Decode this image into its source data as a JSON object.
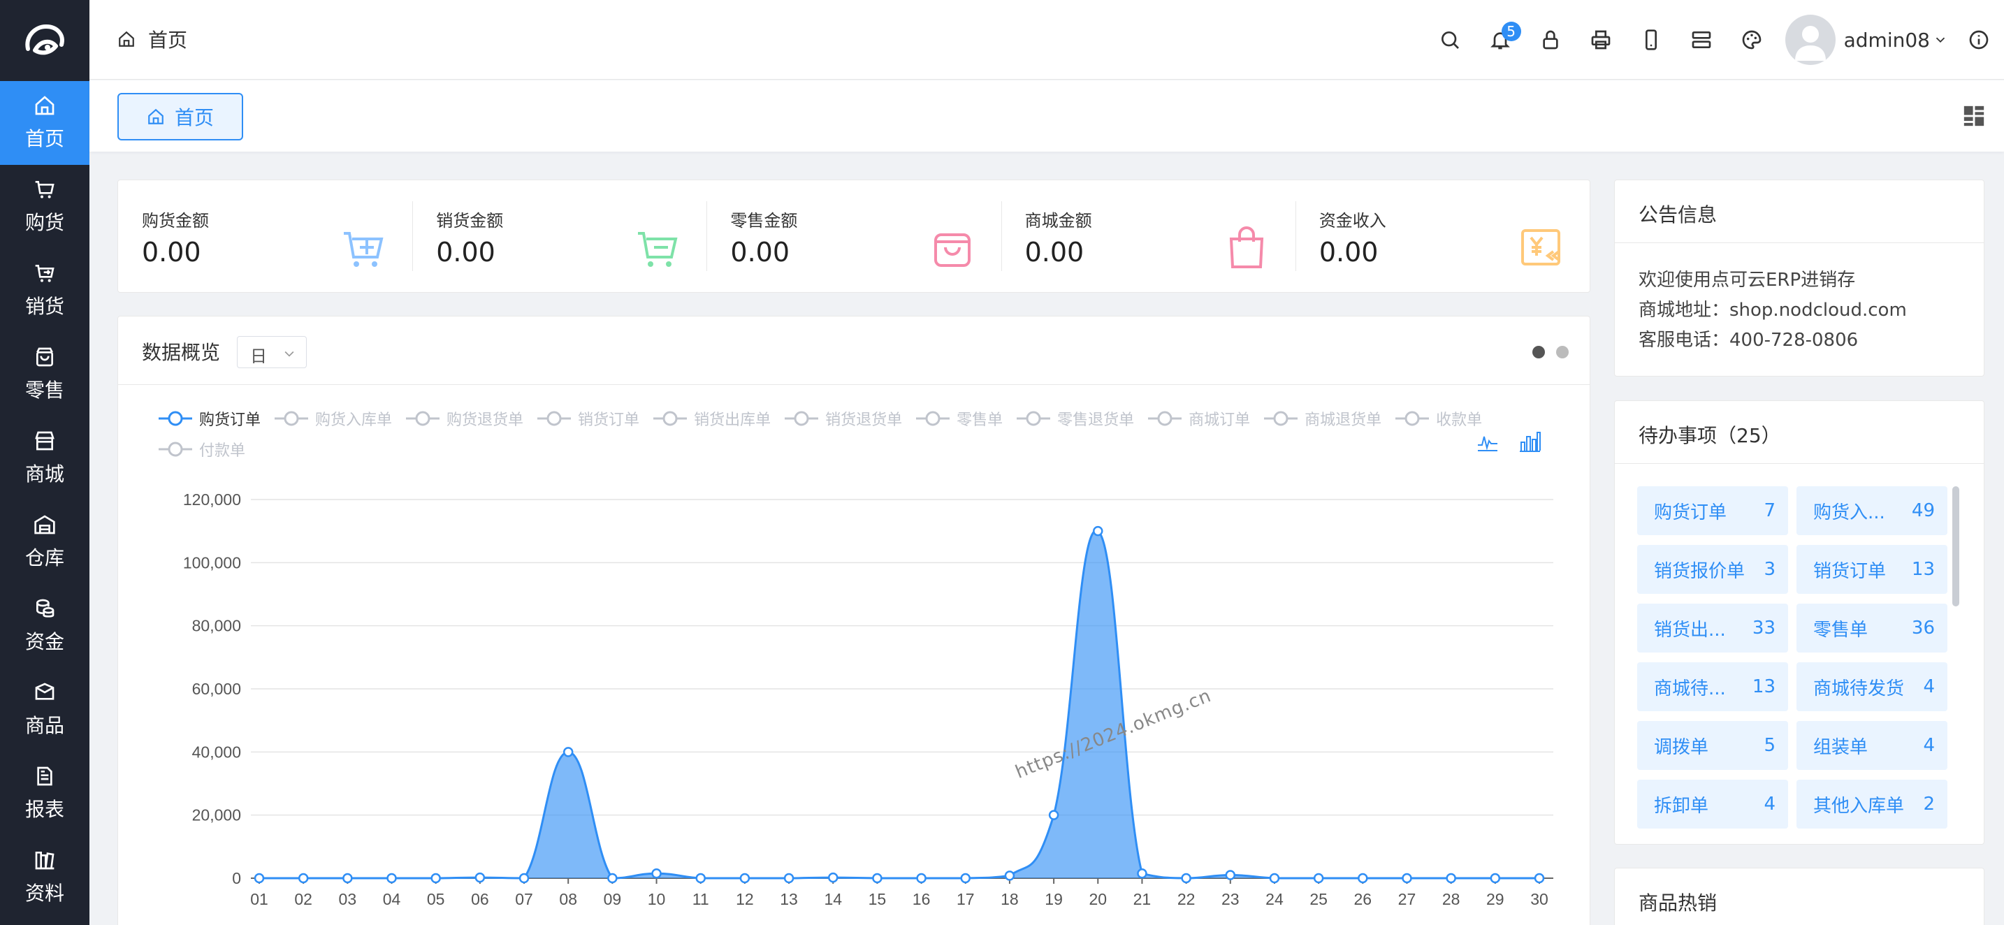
{
  "sidebar": {
    "items": [
      {
        "label": "首页",
        "icon": "home-icon",
        "active": true
      },
      {
        "label": "购货",
        "icon": "cart-icon"
      },
      {
        "label": "销货",
        "icon": "cart-arrow-icon"
      },
      {
        "label": "零售",
        "icon": "shopping-bag-icon"
      },
      {
        "label": "商城",
        "icon": "store-icon"
      },
      {
        "label": "仓库",
        "icon": "warehouse-icon"
      },
      {
        "label": "资金",
        "icon": "coins-icon"
      },
      {
        "label": "商品",
        "icon": "box-icon"
      },
      {
        "label": "报表",
        "icon": "report-icon"
      },
      {
        "label": "资料",
        "icon": "books-icon"
      }
    ]
  },
  "header": {
    "breadcrumb": "首页",
    "notification_count": "5",
    "username": "admin08",
    "tools": [
      "search-icon",
      "bell-icon",
      "lock-icon",
      "printer-icon",
      "mobile-icon",
      "server-icon",
      "palette-icon"
    ]
  },
  "tabs": {
    "active": "首页"
  },
  "stats": [
    {
      "label": "购货金额",
      "value": "0.00",
      "icon": "cart-plus-icon",
      "color": "#8cc2ff"
    },
    {
      "label": "销货金额",
      "value": "0.00",
      "icon": "cart-minus-icon",
      "color": "#7ee2a8"
    },
    {
      "label": "零售金额",
      "value": "0.00",
      "icon": "bag-icon",
      "color": "#f58aaa"
    },
    {
      "label": "商城金额",
      "value": "0.00",
      "icon": "handbag-icon",
      "color": "#f58aaa"
    },
    {
      "label": "资金收入",
      "value": "0.00",
      "icon": "income-icon",
      "color": "#ffc97a"
    }
  ],
  "overview": {
    "title": "数据概览",
    "period": "日",
    "legend": [
      "购货订单",
      "购货入库单",
      "购货退货单",
      "销货订单",
      "销货出库单",
      "销货退货单",
      "零售单",
      "零售退货单",
      "商城订单",
      "商城退货单",
      "收款单",
      "付款单"
    ],
    "watermark": "https://2024.okmg.cn"
  },
  "chart_data": {
    "type": "area",
    "categories": [
      "01",
      "02",
      "03",
      "04",
      "05",
      "06",
      "07",
      "08",
      "09",
      "10",
      "11",
      "12",
      "13",
      "14",
      "15",
      "16",
      "17",
      "18",
      "19",
      "20",
      "21",
      "22",
      "23",
      "24",
      "25",
      "26",
      "27",
      "28",
      "29",
      "30"
    ],
    "series": [
      {
        "name": "购货订单",
        "color": "#2f8ef5",
        "values": [
          0,
          0,
          0,
          0,
          0,
          200,
          0,
          40000,
          0,
          1500,
          0,
          0,
          0,
          200,
          0,
          0,
          0,
          800,
          20000,
          110000,
          1500,
          0,
          1000,
          0,
          0,
          0,
          0,
          0,
          0,
          0
        ]
      }
    ],
    "ylim": [
      0,
      120000
    ],
    "yticks": [
      "0",
      "20,000",
      "40,000",
      "60,000",
      "80,000",
      "100,000",
      "120,000"
    ],
    "grid": true
  },
  "notice": {
    "title": "公告信息",
    "lines": [
      "欢迎使用点可云ERP进销存",
      "商城地址：shop.nodcloud.com",
      "客服电话：400-728-0806"
    ]
  },
  "todo": {
    "title": "待办事项（25）",
    "items": [
      {
        "label": "购货订单",
        "count": "7"
      },
      {
        "label": "购货入...",
        "count": "49"
      },
      {
        "label": "销货报价单",
        "count": "3"
      },
      {
        "label": "销货订单",
        "count": "13"
      },
      {
        "label": "销货出...",
        "count": "33"
      },
      {
        "label": "零售单",
        "count": "36"
      },
      {
        "label": "商城待...",
        "count": "13"
      },
      {
        "label": "商城待发货",
        "count": "4"
      },
      {
        "label": "调拨单",
        "count": "5"
      },
      {
        "label": "组装单",
        "count": "4"
      },
      {
        "label": "拆卸单",
        "count": "4"
      },
      {
        "label": "其他入库单",
        "count": "2"
      }
    ]
  },
  "hot": {
    "title": "商品热销"
  }
}
